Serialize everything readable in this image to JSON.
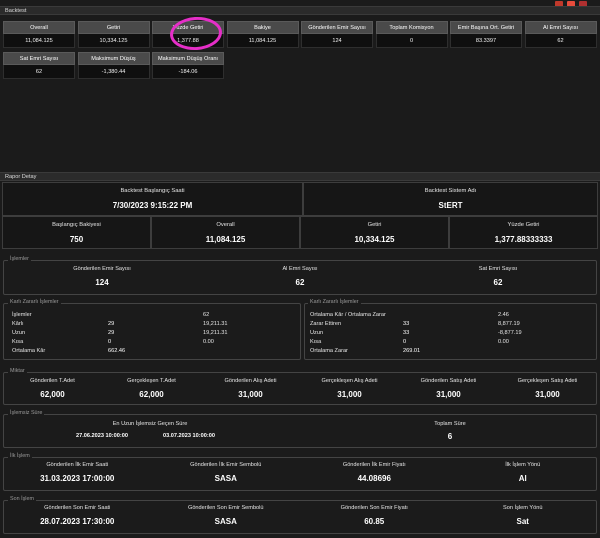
{
  "toolbar": {
    "icon_colors": [
      "#c0392b",
      "#e74c3c",
      "#b03030"
    ]
  },
  "backtest": {
    "header": "Backtest",
    "tiles_row1": [
      {
        "label": "Overall",
        "value": "11,084.125"
      },
      {
        "label": "Getiri",
        "value": "10,334.125"
      },
      {
        "label": "Yüzde Getiri",
        "value": "1,377.88"
      },
      {
        "label": "Bakiye",
        "value": "11,084.125"
      },
      {
        "label": "Gönderilen Emir Sayısı",
        "value": "124"
      },
      {
        "label": "Toplam Komisyon",
        "value": "0"
      },
      {
        "label": "Emir Başına Ort. Getiri",
        "value": "83.3397"
      },
      {
        "label": "Al Emri Sayısı",
        "value": "62"
      }
    ],
    "tiles_row2": [
      {
        "label": "Sat Emri Sayısı",
        "value": "62"
      },
      {
        "label": "Maksimum Düşüş",
        "value": "-1,380.44"
      },
      {
        "label": "Maksimum Düşüş Oranı",
        "value": "-184.06"
      }
    ],
    "highlight_color": "#e62ec8"
  },
  "rapor": {
    "header": "Rapor Detay",
    "start_label": "Backtest Başlangıç Saati",
    "start_value": "7/30/2023 9:15:22 PM",
    "system_label": "Backtest Sistem Adı",
    "system_value": "StERT",
    "summary": [
      {
        "label": "Başlangıç Bakiyesi",
        "value": "750"
      },
      {
        "label": "Overall",
        "value": "11,084.125"
      },
      {
        "label": "Getiri",
        "value": "10,334.125"
      },
      {
        "label": "Yüzde Getiri",
        "value": "1,377.88333333"
      }
    ],
    "islemler": {
      "title": "İşlemler",
      "cols": [
        {
          "label": "Gönderilen Emir Sayısı",
          "value": "124"
        },
        {
          "label": "Al Emri Sayısı",
          "value": "62"
        },
        {
          "label": "Sat Emri Sayısı",
          "value": "62"
        }
      ]
    },
    "karli_left": {
      "title": "Karlı Zararlı İşlemler",
      "rows": [
        {
          "label": "İşlemler",
          "a": "",
          "b": "62"
        },
        {
          "label": "Kârlı",
          "a": "29",
          "b": "19,211.31"
        },
        {
          "label": "Uzun",
          "a": "29",
          "b": "19,211.31"
        },
        {
          "label": "Kısa",
          "a": "0",
          "b": "0.00"
        },
        {
          "label": "Ortalama Kâr",
          "a": "662.46",
          "b": ""
        }
      ]
    },
    "karli_right": {
      "title": "Karlı Zararlı İşlemler",
      "rows": [
        {
          "label": "Ortalama Kâr / Ortalama Zarar",
          "a": "",
          "b": "2.46"
        },
        {
          "label": "Zarar Ettiren",
          "a": "33",
          "b": "8,877.19"
        },
        {
          "label": "Uzun",
          "a": "33",
          "b": "-8,877.19"
        },
        {
          "label": "Kısa",
          "a": "0",
          "b": "0.00"
        },
        {
          "label": "Ortalama Zarar",
          "a": "269.01",
          "b": ""
        }
      ]
    },
    "miktar": {
      "title": "Miktar",
      "cols": [
        {
          "label": "Gönderilen T.Adet",
          "value": "62,000"
        },
        {
          "label": "Gerçekleşen T.Adet",
          "value": "62,000"
        },
        {
          "label": "Gönderilen Alış Adeti",
          "value": "31,000"
        },
        {
          "label": "Gerçekleşen Alış Adeti",
          "value": "31,000"
        },
        {
          "label": "Gönderilen Satış Adeti",
          "value": "31,000"
        },
        {
          "label": "Gerçekleşen Satış Adeti",
          "value": "31,000"
        }
      ]
    },
    "islemsiz": {
      "title": "İşlemsiz Süre",
      "label": "En Uzun İşlemsiz Geçen Süre",
      "from": "27.06.2023 10:00:00",
      "to": "03.07.2023 10:00:00",
      "total_label": "Toplam Süre",
      "total_value": "6"
    },
    "ilk": {
      "title": "İlk İşlem",
      "cols": [
        {
          "label": "Gönderilen İlk Emir Saati",
          "value": "31.03.2023 17:00:00"
        },
        {
          "label": "Gönderilen İlk Emir Sembolü",
          "value": "SASA"
        },
        {
          "label": "Gönderilen İlk Emir Fiyatı",
          "value": "44.08696"
        },
        {
          "label": "İlk İşlem Yönü",
          "value": "Al"
        }
      ]
    },
    "son": {
      "title": "Son İşlem",
      "cols": [
        {
          "label": "Gönderilen Son Emir Saati",
          "value": "28.07.2023 17:30:00"
        },
        {
          "label": "Gönderilen Son Emir Sembolü",
          "value": "SASA"
        },
        {
          "label": "Gönderilen Son Emir Fiyatı",
          "value": "60.85"
        },
        {
          "label": "Son İşlem Yönü",
          "value": "Sat"
        }
      ]
    }
  }
}
